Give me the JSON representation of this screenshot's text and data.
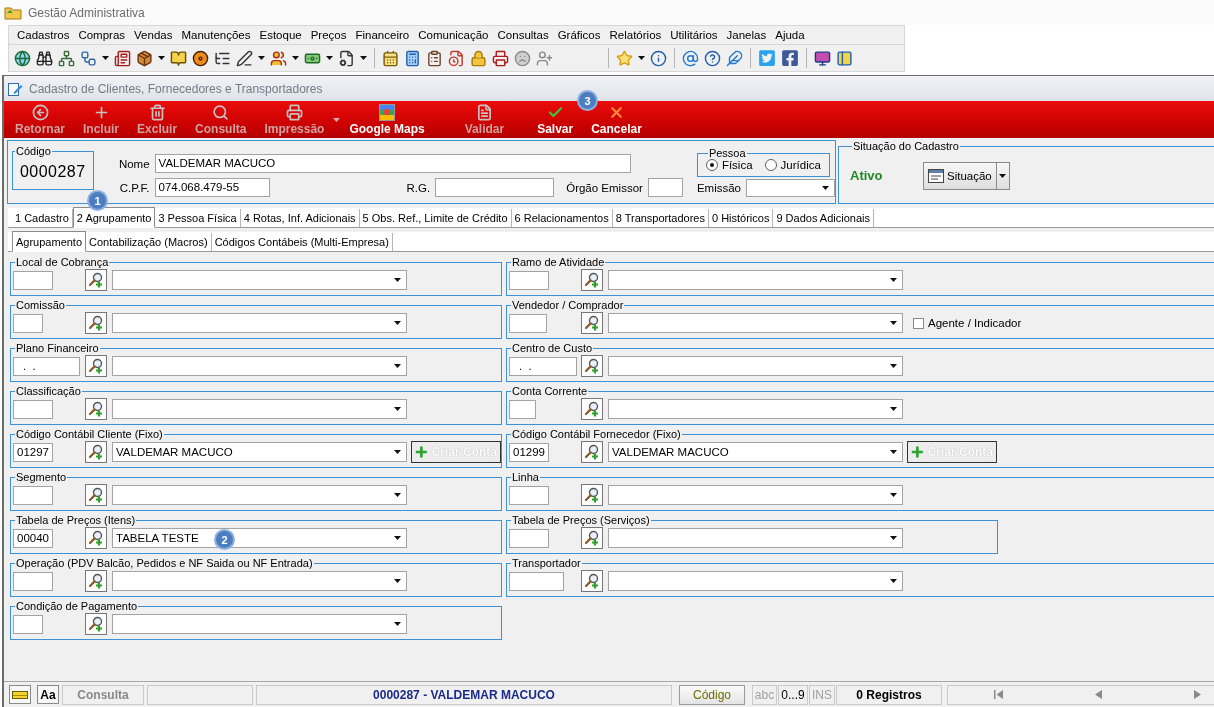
{
  "app": {
    "title": "Gestão Administrativa"
  },
  "menu": [
    "Cadastros",
    "Compras",
    "Vendas",
    "Manutenções",
    "Estoque",
    "Preços",
    "Financeiro",
    "Comunicação",
    "Consultas",
    "Gráficos",
    "Relatórios",
    "Utilitários",
    "Janelas",
    "Ajuda"
  ],
  "window": {
    "title": "Cadastro de Clientes, Fornecedores e Transportadores"
  },
  "actions": [
    {
      "label": "Retornar",
      "disabled": true,
      "dropdown": false
    },
    {
      "label": "Incluir",
      "disabled": true,
      "dropdown": false
    },
    {
      "label": "Excluir",
      "disabled": true,
      "dropdown": false
    },
    {
      "label": "Consulta",
      "disabled": true,
      "dropdown": false
    },
    {
      "label": "Impressão",
      "disabled": true,
      "dropdown": true
    },
    {
      "label": "Google Maps",
      "disabled": false,
      "dropdown": false
    },
    {
      "label": "Validar",
      "disabled": true,
      "dropdown": false
    },
    {
      "label": "Salvar",
      "disabled": false,
      "dropdown": false
    },
    {
      "label": "Cancelar",
      "disabled": false,
      "dropdown": false
    }
  ],
  "record": {
    "code_label": "Código",
    "code": "0000287",
    "name_label": "Nome",
    "name": "VALDEMAR MACUCO",
    "cpf_label": "C.P.F.",
    "cpf": "074.068.479-55",
    "rg_label": "R.G.",
    "issuer_label": "Órgão Emissor",
    "person_type": {
      "label": "Pessoa",
      "options": [
        {
          "label": "Física",
          "selected": true
        },
        {
          "label": "Jurídica",
          "selected": false
        }
      ]
    },
    "issue_label": "Emissão"
  },
  "registration_status": {
    "title": "Situação do Cadastro",
    "status": "Ativo",
    "button": "Situação"
  },
  "tabs": [
    {
      "label": "1 Cadastro",
      "selected": false
    },
    {
      "label": "2 Agrupamento",
      "selected": true
    },
    {
      "label": "3 Pessoa Física",
      "selected": false
    },
    {
      "label": "4 Rotas, Inf. Adicionais",
      "selected": false
    },
    {
      "label": "5 Obs. Ref., Limite de Crédito",
      "selected": false
    },
    {
      "label": "6 Relacionamentos",
      "selected": false
    },
    {
      "label": "8 Transportadores",
      "selected": false
    },
    {
      "label": "0 Históricos",
      "selected": false
    },
    {
      "label": "9 Dados Adicionais",
      "selected": false
    }
  ],
  "subtabs": [
    {
      "label": "Agrupamento",
      "selected": true
    },
    {
      "label": "Contabilização (Macros)",
      "selected": false
    },
    {
      "label": "Códigos Contábeis (Multi-Empresa)",
      "selected": false
    }
  ],
  "group_rows": [
    {
      "left": {
        "title": "Local de Cobrança"
      },
      "right": {
        "title": "Ramo de Atividade"
      }
    },
    {
      "left": {
        "title": "Comissão"
      },
      "right": {
        "title": "Vendedor / Comprador",
        "checkbox": {
          "label": "Agente / Indicador",
          "checked": false
        }
      }
    },
    {
      "left": {
        "title": "Plano Financeiro",
        "code": ".  ."
      },
      "right": {
        "title": "Centro de Custo",
        "code": ".  ."
      }
    },
    {
      "left": {
        "title": "Classificação"
      },
      "right": {
        "title": "Conta Corrente"
      }
    },
    {
      "left": {
        "title": "Código Contábil Cliente (Fixo)",
        "code": "01297",
        "description": "VALDEMAR MACUCO",
        "action": {
          "label": "Criar Conta",
          "disabled": true
        }
      },
      "right": {
        "title": "Código Contábil Fornecedor (Fixo)",
        "code": "01299",
        "description": "VALDEMAR MACUCO",
        "action": {
          "label": "Criar Conta",
          "disabled": true
        }
      }
    },
    {
      "left": {
        "title": "Segmento"
      },
      "right": {
        "title": "Linha"
      }
    },
    {
      "left": {
        "title": "Tabela de Preços (Itens)",
        "code": "00040",
        "description": "TABELA TESTE"
      },
      "right": {
        "title": "Tabela de Preços (Serviços)"
      }
    },
    {
      "left": {
        "title": "Operação (PDV Balcão, Pedidos e NF Saida ou NF Entrada)"
      },
      "right": {
        "title": "Transportador"
      }
    },
    {
      "left": {
        "title": "Condição de Pagamento"
      }
    }
  ],
  "status_bar": {
    "shortcut": "Aa",
    "mode": "Consulta",
    "record": "0000287 - VALDEMAR MACUCO",
    "sort": "Código",
    "indicators": [
      {
        "label": "abc",
        "on": false
      },
      {
        "label": "0...9",
        "on": true
      },
      {
        "label": "INS",
        "on": false
      }
    ],
    "count": "0 Registros"
  },
  "step_markers": [
    {
      "label": "1"
    },
    {
      "label": "2"
    },
    {
      "label": "3"
    }
  ]
}
